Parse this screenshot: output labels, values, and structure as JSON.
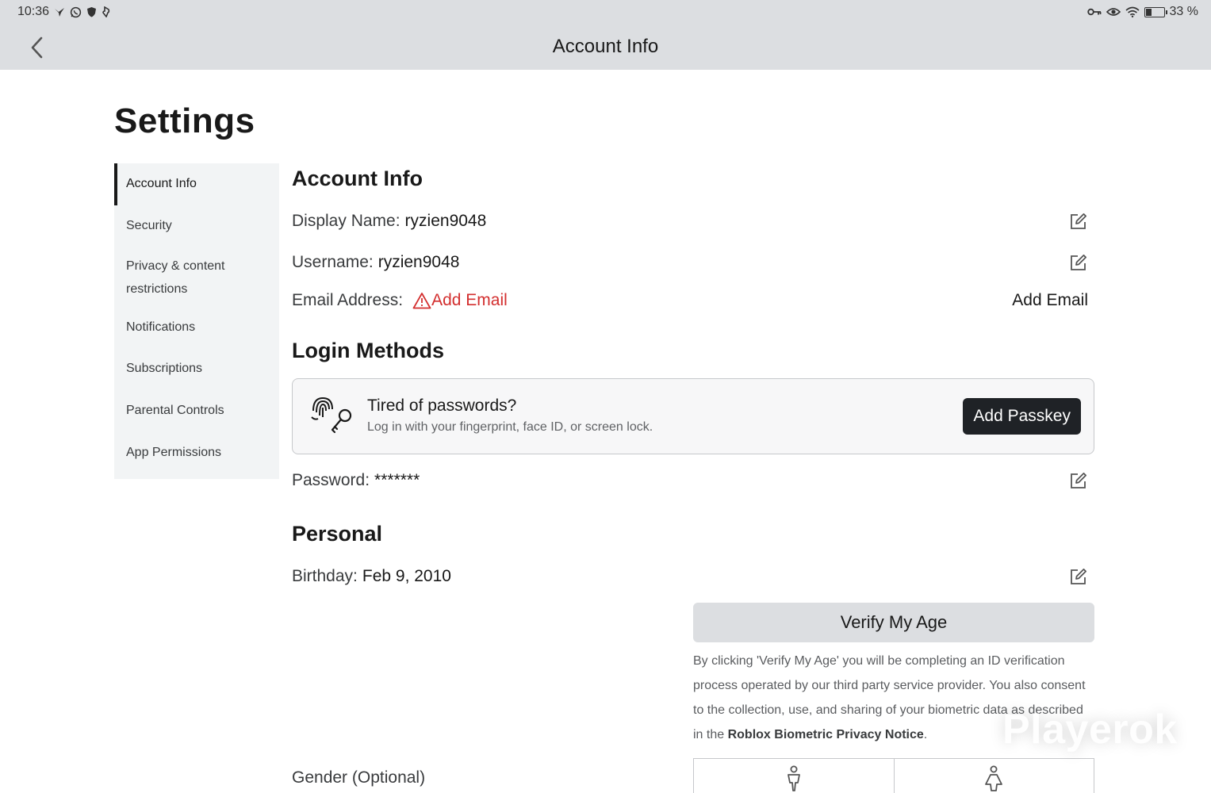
{
  "status_bar": {
    "time": "10:36",
    "battery": "33 %",
    "battery_level": 0.33,
    "left_icons": [
      "bird-icon",
      "whatsapp-icon",
      "shield-icon",
      "notification-icon"
    ],
    "right_icons": [
      "key-icon",
      "eye-icon",
      "wifi-icon",
      "battery-icon"
    ]
  },
  "topbar": {
    "title": "Account Info"
  },
  "page": {
    "title": "Settings"
  },
  "sidebar": {
    "items": [
      {
        "label": "Account Info",
        "active": true
      },
      {
        "label": "Security"
      },
      {
        "label": "Privacy & content restrictions"
      },
      {
        "label": "Notifications"
      },
      {
        "label": "Subscriptions"
      },
      {
        "label": "Parental Controls"
      },
      {
        "label": "App Permissions"
      }
    ]
  },
  "account_info": {
    "heading": "Account Info",
    "display_name_label": "Display Name:",
    "display_name_value": "ryzien9048",
    "username_label": "Username:",
    "username_value": "ryzien9048",
    "email_label": "Email Address:",
    "email_warning_link": "Add Email",
    "email_action": "Add Email"
  },
  "login_methods": {
    "heading": "Login Methods",
    "passkey_title": "Tired of passwords?",
    "passkey_subtitle": "Log in with your fingerprint, face ID, or screen lock.",
    "passkey_button": "Add Passkey",
    "password_label": "Password:",
    "password_value": "*******"
  },
  "personal": {
    "heading": "Personal",
    "birthday_label": "Birthday:",
    "birthday_value": "Feb 9, 2010",
    "verify_button": "Verify My Age",
    "disclaimer_text": "By clicking 'Verify My Age' you will be completing an ID verification process operated by our third party service provider. You also consent to the collection, use, and sharing of your biometric data as described in the ",
    "disclaimer_link": "Roblox Biometric Privacy Notice",
    "disclaimer_end": ".",
    "gender_label": "Gender (Optional)"
  },
  "watermark": "Playerok",
  "colors": {
    "warning": "#d32f2f",
    "button_dark": "#1f2226",
    "header_bg": "#dcdee1"
  }
}
